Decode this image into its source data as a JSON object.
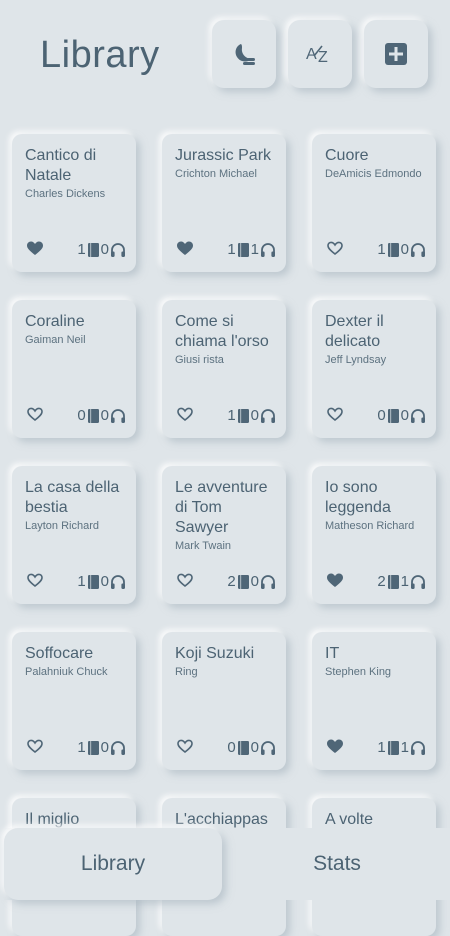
{
  "header": {
    "title": "Library",
    "buttons": [
      {
        "name": "theme-toggle-button",
        "icon": "moon-icon"
      },
      {
        "name": "sort-button",
        "icon": "sort-az-icon"
      },
      {
        "name": "add-book-button",
        "icon": "plus-square-icon"
      }
    ]
  },
  "books": [
    {
      "title": "Cantico di Natale",
      "author": "Charles Dickens",
      "favorite": true,
      "ebooks": "1",
      "audiobooks": "0"
    },
    {
      "title": "Jurassic Park",
      "author": "Crichton Michael",
      "favorite": true,
      "ebooks": "1",
      "audiobooks": "1"
    },
    {
      "title": "Cuore",
      "author": "DeAmicis Edmondo",
      "favorite": false,
      "ebooks": "1",
      "audiobooks": "0"
    },
    {
      "title": "Coraline",
      "author": "Gaiman Neil",
      "favorite": false,
      "ebooks": "0",
      "audiobooks": "0"
    },
    {
      "title": "Come si chiama l'orso",
      "author": "Giusi rista",
      "favorite": false,
      "ebooks": "1",
      "audiobooks": "0"
    },
    {
      "title": "Dexter il delicato",
      "author": "Jeff Lyndsay",
      "favorite": false,
      "ebooks": "0",
      "audiobooks": "0"
    },
    {
      "title": "La casa della bestia",
      "author": "Layton Richard",
      "favorite": false,
      "ebooks": "1",
      "audiobooks": "0"
    },
    {
      "title": "Le avventure di Tom Sawyer",
      "author": "Mark Twain",
      "favorite": false,
      "ebooks": "2",
      "audiobooks": "0"
    },
    {
      "title": "Io sono leggenda",
      "author": "Matheson Richard",
      "favorite": true,
      "ebooks": "2",
      "audiobooks": "1"
    },
    {
      "title": "Soffocare",
      "author": "Palahniuk Chuck",
      "favorite": false,
      "ebooks": "1",
      "audiobooks": "0"
    },
    {
      "title": "Koji Suzuki",
      "author": "Ring",
      "favorite": false,
      "ebooks": "0",
      "audiobooks": "0"
    },
    {
      "title": "IT",
      "author": "Stephen King",
      "favorite": true,
      "ebooks": "1",
      "audiobooks": "1"
    },
    {
      "title": "Il miglio",
      "author": "",
      "favorite": false,
      "ebooks": "",
      "audiobooks": ""
    },
    {
      "title": "L'acchiappas",
      "author": "",
      "favorite": false,
      "ebooks": "",
      "audiobooks": ""
    },
    {
      "title": "A volte",
      "author": "",
      "favorite": false,
      "ebooks": "",
      "audiobooks": ""
    }
  ],
  "tabs": [
    {
      "label": "Library",
      "active": true
    },
    {
      "label": "Stats",
      "active": false
    }
  ],
  "colors": {
    "background": "#dfe5e9",
    "text": "#4c6373"
  }
}
